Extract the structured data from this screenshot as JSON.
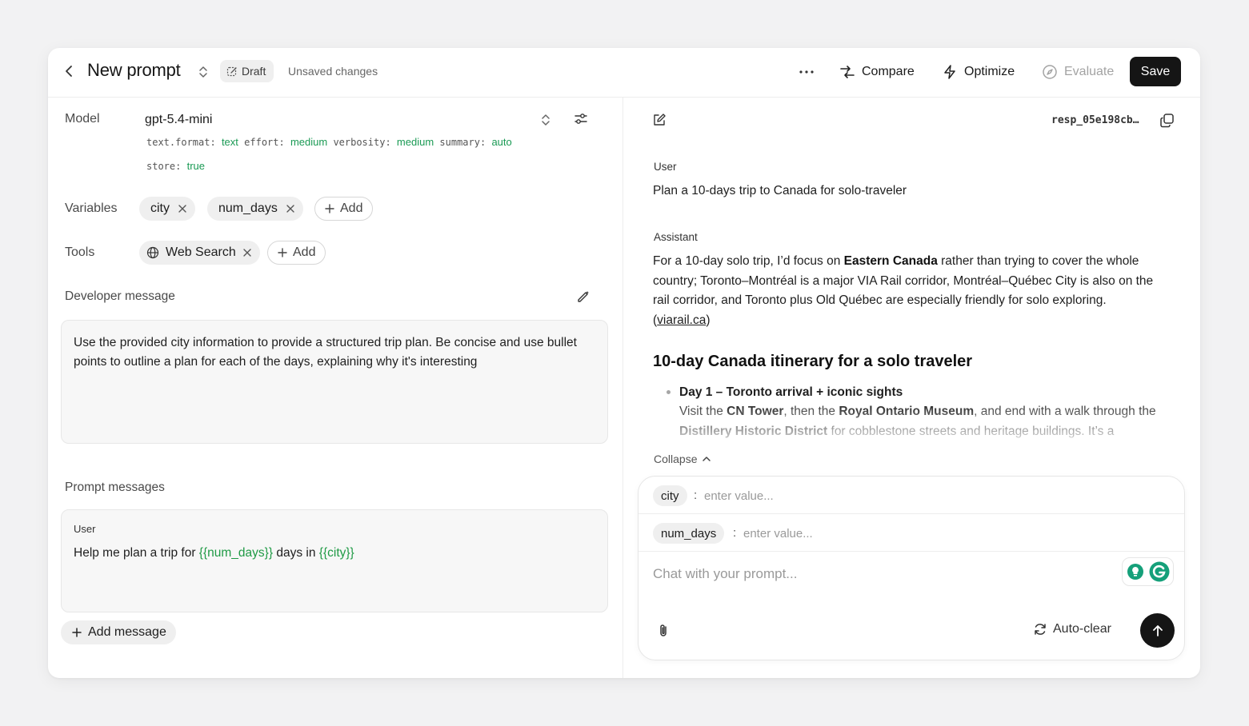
{
  "header": {
    "title": "New prompt",
    "draft_label": "Draft",
    "unsaved_label": "Unsaved changes",
    "compare_label": "Compare",
    "optimize_label": "Optimize",
    "evaluate_label": "Evaluate",
    "save_label": "Save"
  },
  "config": {
    "model_label": "Model",
    "model_name": "gpt-5.4-mini",
    "params": {
      "text_format_key": "text.format:",
      "text_format_val": "text",
      "effort_key": "effort:",
      "effort_val": "medium",
      "verbosity_key": "verbosity:",
      "verbosity_val": "medium",
      "summary_key": "summary:",
      "summary_val": "auto",
      "store_key": "store:",
      "store_val": "true"
    },
    "variables_label": "Variables",
    "variables": [
      "city",
      "num_days"
    ],
    "add_label": "Add",
    "tools_label": "Tools",
    "tools": [
      "Web Search"
    ]
  },
  "developer": {
    "label": "Developer message",
    "text": "Use the provided city information to provide a structured trip plan. Be concise and use bullet points to outline a plan for each of the days, explaining why it's interesting"
  },
  "prompt_messages": {
    "label": "Prompt messages",
    "role": "User",
    "text_1": "Help me plan a trip for ",
    "var_1": "{{num_days}}",
    "text_2": " days in ",
    "var_2": "{{city}}",
    "add_message_label": "Add message"
  },
  "response": {
    "id": "resp_05e198cb…",
    "user_role": "User",
    "user_text": "Plan a 10-days trip to Canada for solo-traveler",
    "assistant_role": "Assistant",
    "p1_a": "For a 10-day solo trip, I’d focus on ",
    "p1_b": "Eastern Canada",
    "p1_c": " rather than trying to cover the whole country; Toronto–Montréal is a major VIA Rail corridor, Montréal–Québec City is also on the rail corridor, and Toronto plus Old Québec are especially friendly for solo exploring. (",
    "p1_link": "viarail.ca",
    "p1_d": ")",
    "heading": "10-day Canada itinerary for a solo traveler",
    "day1_title": "Day 1 – Toronto arrival + iconic sights",
    "day1_a": "Visit the ",
    "day1_b": "CN Tower",
    "day1_c": ", then the ",
    "day1_d": "Royal Ontario Museum",
    "day1_e": ", and end with a walk through the ",
    "day1_f": "Distillery Historic District",
    "day1_g": " for cobblestone streets and heritage buildings. It’s a",
    "collapse_label": "Collapse"
  },
  "chat": {
    "var_names": [
      "city",
      "num_days"
    ],
    "var_placeholder": "enter value...",
    "input_placeholder": "Chat with your prompt...",
    "autoclear_label": "Auto-clear"
  },
  "colors": {
    "accent_green": "#1f9a45",
    "primary_button": "#151515",
    "grammarly_green": "#15a07a"
  }
}
